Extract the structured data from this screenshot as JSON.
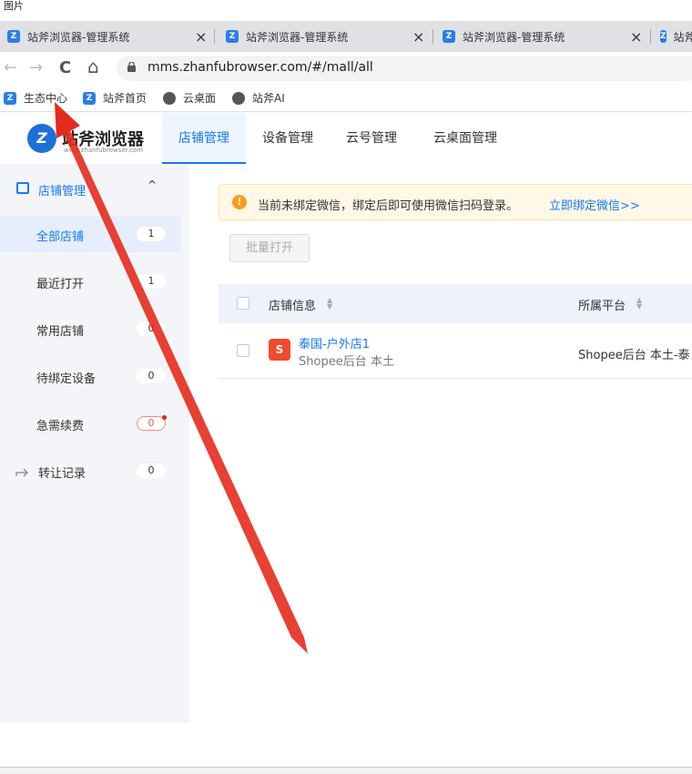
{
  "caption": "图片",
  "tabs": [
    {
      "title": "站斧浏览器-管理系统",
      "close": "×"
    },
    {
      "title": "站斧浏览器-管理系统",
      "close": "×"
    },
    {
      "title": "站斧浏览器-管理系统",
      "close": "×"
    },
    {
      "title": "站斧",
      "close": ""
    }
  ],
  "nav": {
    "back": "←",
    "forward": "→",
    "reload": "C",
    "home": "⌂"
  },
  "address": {
    "url": "mms.zhanfubrowser.com/#/mall/all"
  },
  "bookmarks": [
    {
      "label": "生态中心",
      "icon": "app-icon"
    },
    {
      "label": "站斧首页",
      "icon": "app-icon"
    },
    {
      "label": "云桌面",
      "icon": "globe-icon"
    },
    {
      "label": "站斧AI",
      "icon": "globe-icon"
    }
  ],
  "header": {
    "brand": "站斧浏览器",
    "brand_sub": "www.zhanfubrowser.com",
    "logo_letter": "Z",
    "tabs": [
      "店铺管理",
      "设备管理",
      "云号管理",
      "云桌面管理"
    ]
  },
  "sidebar": {
    "section_title": "店铺管理",
    "chevron": "^",
    "items": [
      {
        "label": "全部店铺",
        "count": "1"
      },
      {
        "label": "最近打开",
        "count": "1"
      },
      {
        "label": "常用店铺",
        "count": "0"
      },
      {
        "label": "待绑定设备",
        "count": "0"
      },
      {
        "label": "急需续费",
        "count": "0"
      },
      {
        "label": "转让记录",
        "count": "0"
      }
    ]
  },
  "main": {
    "alert_icon": "!",
    "alert_text": "当前未绑定微信，绑定后即可使用微信扫码登录。",
    "alert_link": "立即绑定微信>>",
    "batch_button": "批量打开",
    "columns": [
      "店铺信息",
      "所属平台"
    ],
    "rows": [
      {
        "name": "泰国-户外店1",
        "sub": "Shopee后台 本土",
        "platform": "Shopee后台 本土-泰",
        "icon": "S"
      }
    ]
  },
  "colors": {
    "accent": "#1677ff",
    "arrow": "#e52b1c",
    "alert_bg": "#fff8e6"
  }
}
